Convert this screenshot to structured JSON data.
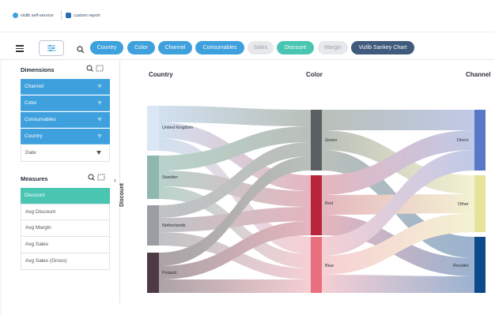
{
  "breadcrumb": {
    "app": "vizlib self-service",
    "page": "custom report"
  },
  "toolbar": {
    "pills": [
      {
        "label": "Country",
        "state": "active"
      },
      {
        "label": "Color",
        "state": "active"
      },
      {
        "label": "Channel",
        "state": "active"
      },
      {
        "label": "Consumables",
        "state": "active"
      },
      {
        "label": "Sales",
        "state": "inactive"
      },
      {
        "label": "Discount",
        "state": "selected"
      },
      {
        "label": "Margin",
        "state": "inactive"
      },
      {
        "label": "Vizlib Sankey Chart",
        "state": "chart"
      }
    ]
  },
  "dimensions": {
    "title": "Dimensions",
    "items": [
      "Channel",
      "Color",
      "Consumables",
      "Country",
      "Date"
    ]
  },
  "measures": {
    "title": "Measures",
    "items": [
      "Discount",
      "Avg Discount",
      "Avg Margin",
      "Avg Sales",
      "Avg Sales (Gross)"
    ]
  },
  "chart": {
    "columns": [
      "Country",
      "Color",
      "Channel"
    ],
    "measure_label": "Discount",
    "nodes": {
      "country": [
        "United Kingdom",
        "Sweden",
        "Netherlands",
        "Finland"
      ],
      "color": [
        "Green",
        "Red",
        "Blue"
      ],
      "channel": [
        "Direct",
        "Other",
        "Reseller"
      ]
    }
  },
  "colors": {
    "accent_blue": "#3ea0dd",
    "teal": "#49c5b1",
    "navy": "#3f5a7c",
    "green_node": "#5b5f63",
    "red_node": "#b8253a",
    "blue_node": "#e8707e",
    "direct_node": "#5a78c8",
    "other_node": "#e6e39a",
    "reseller_node": "#0d4a8c"
  }
}
